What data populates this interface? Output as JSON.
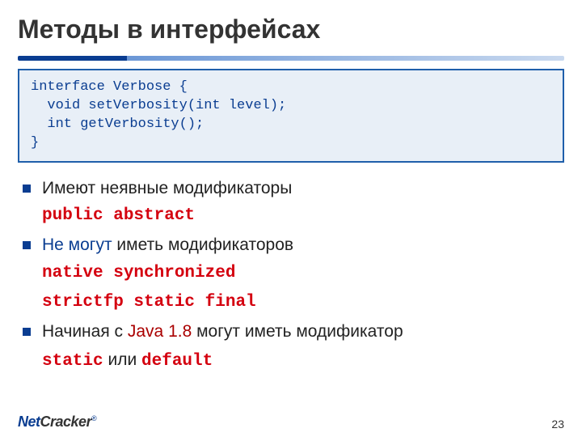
{
  "title": "Методы в интерфейсах",
  "code": "interface Verbose {\n  void setVerbosity(int level);\n  int getVerbosity();\n}",
  "bullets": {
    "b1": {
      "text": "Имеют неявные модификаторы",
      "extra": "public abstract"
    },
    "b2": {
      "pre": "Не могут",
      "post": " иметь модификаторов",
      "extra1": "native synchronized",
      "extra2": "strictfp static final"
    },
    "b3": {
      "pre": "Начиная с ",
      "java": "Java 1.8",
      "post": " могут иметь модификатор",
      "mod1": "static",
      "or": " или ",
      "mod2": "default"
    }
  },
  "logo": {
    "net": "Net",
    "cracker": "Cracker",
    "mark": "®"
  },
  "page": "23"
}
